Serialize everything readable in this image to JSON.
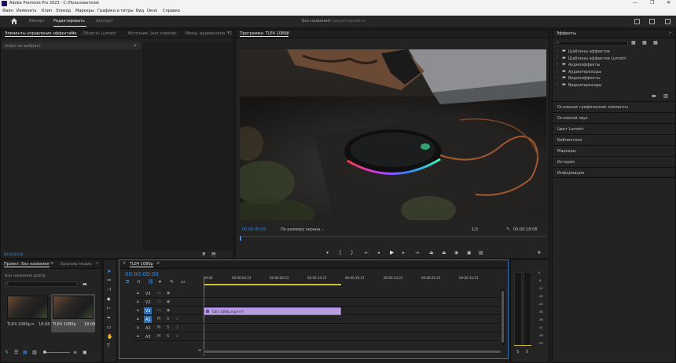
{
  "titlebar": {
    "title": "Adobe Premiere Pro 2023 - C:\\Пользователи\\",
    "minimize": "—",
    "maximize": "❐",
    "close": "✕"
  },
  "menu": [
    "Файл",
    "Изменить",
    "Клип",
    "Эпизод",
    "Маркеры",
    "Графика и титры",
    "Вид",
    "Окно",
    "Справка"
  ],
  "workspace": {
    "tabs": [
      "Импорт",
      "Редактировать",
      "Экспорт"
    ],
    "active": "Редактировать",
    "center_title": "Без названия",
    "center_sub": " - Отредактировано"
  },
  "source_panel": {
    "tabs": [
      "Элементы управления эффектами",
      "Область Lumetri",
      "Источник: (нет клипов)",
      "Микш. аудиоклипа: Т1"
    ],
    "no_clip": "(клип не выбран)",
    "timecode": "00:00:00:00"
  },
  "program_panel": {
    "tab": "Программа: TLE4 1080p",
    "timecode_left": "00:00:00:00",
    "fit": "По размеру экрана",
    "scale": "1/2",
    "timecode_right": "00:00:18:08"
  },
  "right_panel": {
    "title": "Эффекты",
    "search_placeholder": "",
    "tree": [
      "Шаблоны эффектов",
      "Шаблоны эффектов Lumetri",
      "Аудиоэффекты",
      "Аудиопереходы",
      "Видеоэффекты",
      "Видеопереходы"
    ],
    "sections": [
      "Основные графические элементы",
      "Основной звук",
      "Цвет Lumetri",
      "Библиотеки",
      "Маркеры",
      "История",
      "Информация"
    ]
  },
  "project_panel": {
    "tabs": [
      "Проект: Без названия",
      "Браузер медиа"
    ],
    "bin_label": "Без названия.prproj",
    "items": [
      {
        "name": "TLE4 1080p.mp4",
        "duration": "18:08"
      },
      {
        "name": "TLE4 1080p",
        "duration": "18:08"
      }
    ]
  },
  "timeline": {
    "tab": "TLE4 1080p",
    "timecode": "00:00:00:00",
    "ruler": [
      "00:00",
      "00:00:04:23",
      "00:00:09:23",
      "00:00:14:23",
      "00:00:19:23",
      "00:00:24:23",
      "00:00:29:23",
      "00:00:34:23"
    ],
    "video_tracks": [
      "V3",
      "V2",
      "V1"
    ],
    "audio_tracks": [
      "A1",
      "A2",
      "A3"
    ],
    "clip_label": "TLE4 1080p.mp4 [V]"
  },
  "meter": {
    "scale": [
      "0",
      "-6",
      "-12",
      "-18",
      "-24",
      "-30",
      "-36",
      "-42",
      "-48",
      "-54"
    ],
    "bottom": [
      "S",
      "S"
    ]
  }
}
